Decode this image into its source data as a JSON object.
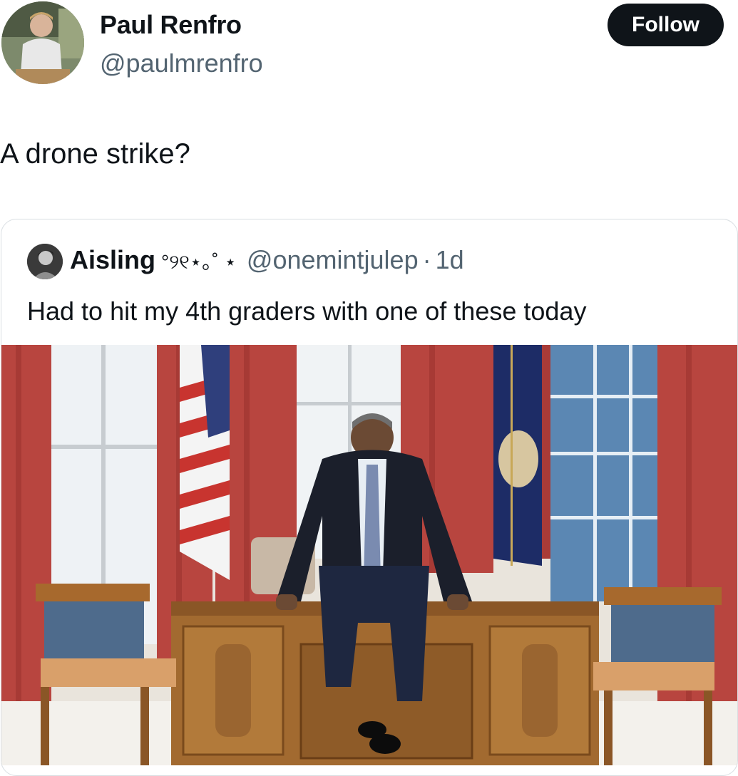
{
  "author": {
    "name": "Paul Renfro",
    "handle": "@paulmrenfro",
    "avatar_icon": "profile-photo"
  },
  "follow_label": "Follow",
  "post_text": "A drone strike?",
  "quoted": {
    "name": "Aisling",
    "name_decoration": "°୨୧⋆｡˚ ⋆",
    "handle": "@onemintjulep",
    "separator": "·",
    "time": "1d",
    "text": "Had to hit my 4th graders with one of these today",
    "media_icon": "photo-oval-office"
  },
  "colors": {
    "text": "#0f1419",
    "secondary": "#536471",
    "button_bg": "#0f1419",
    "curtain": "#b8453f",
    "desk": "#a26a30"
  }
}
